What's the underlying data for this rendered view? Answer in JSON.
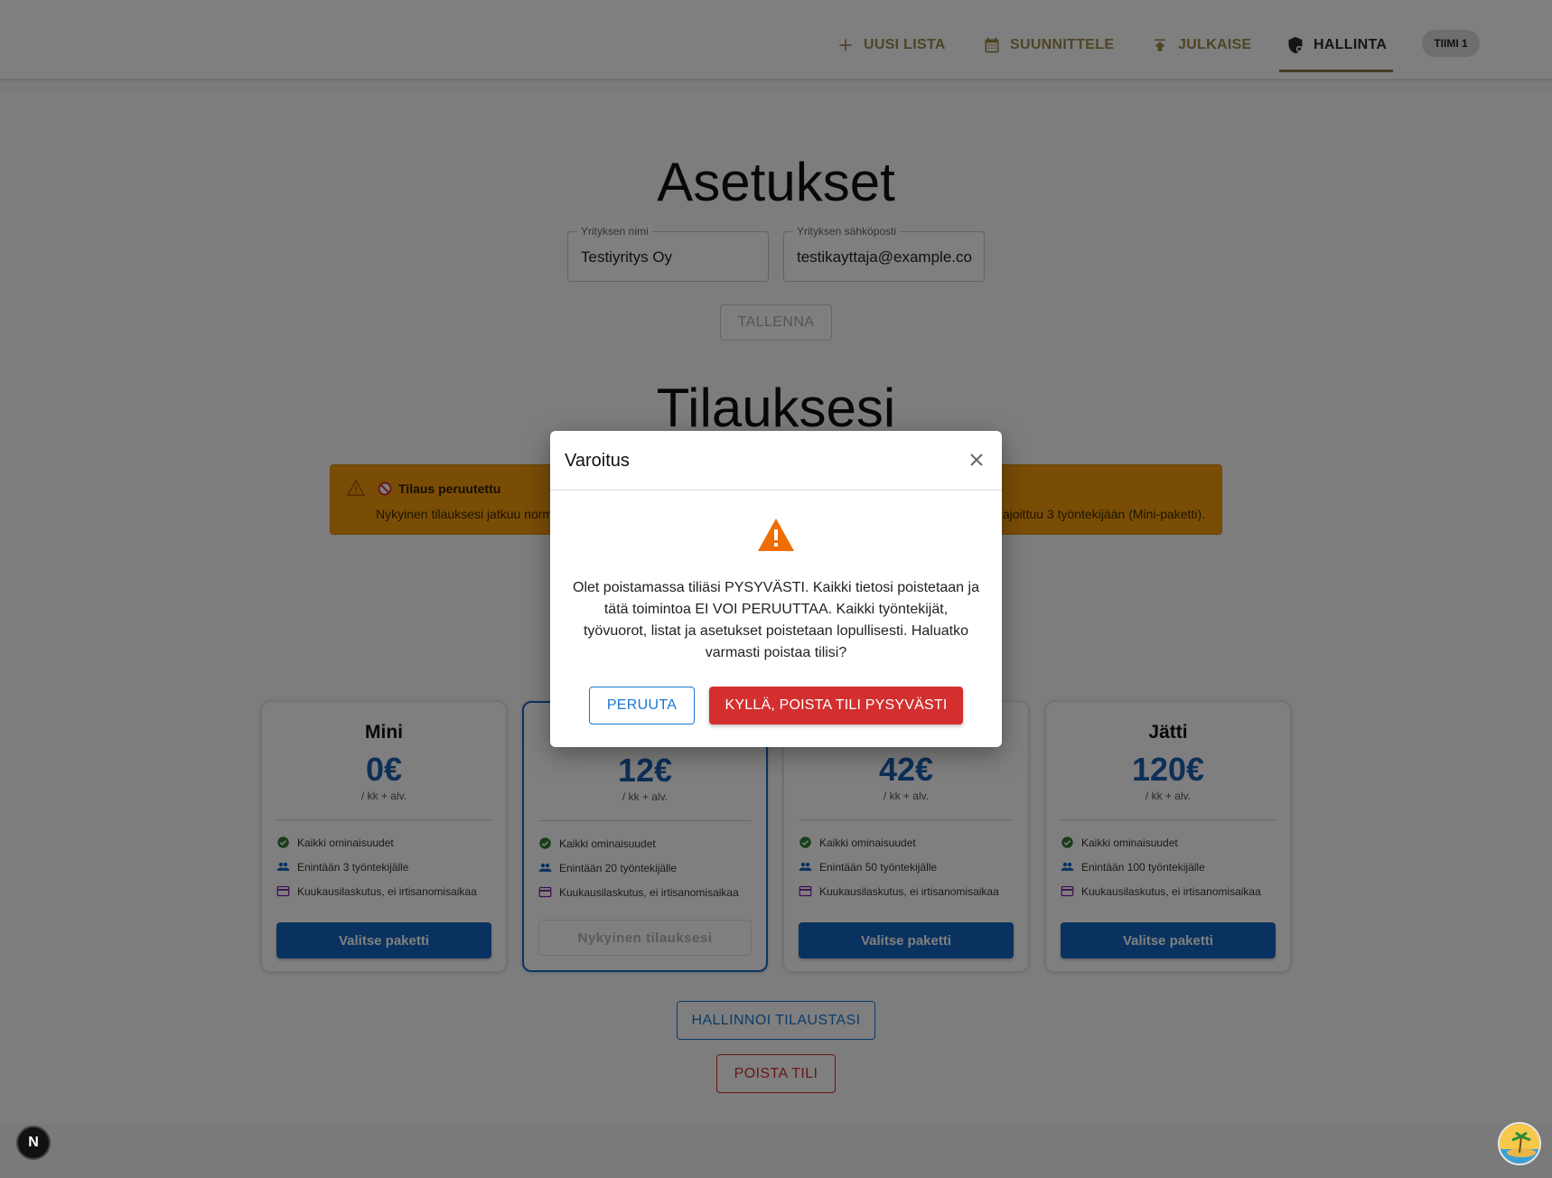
{
  "nav": {
    "items": [
      {
        "label": "UUSI LISTA",
        "icon": "plus-icon"
      },
      {
        "label": "SUUNNITTELE",
        "icon": "calendar-icon"
      },
      {
        "label": "JULKAISE",
        "icon": "publish-icon"
      },
      {
        "label": "HALLINTA",
        "icon": "admin-shield-icon",
        "active": true
      }
    ],
    "team_badge": "TIIMI 1",
    "active_color": "#8a7845"
  },
  "settings": {
    "title": "Asetukset",
    "company_name_label": "Yrityksen nimi",
    "company_name_value": "Testiyritys Oy",
    "company_email_label": "Yrityksen sähköposti",
    "company_email_value": "testikayttaja@example.com",
    "save_label": "TALLENNA"
  },
  "subscription": {
    "title": "Tilauksesi",
    "alert": {
      "title": "Tilaus peruutettu",
      "text_left": "Nykyinen tilauksesi jatkuu norm",
      "text_right": "ajoittuu 3 työntekijään (Mini-paketti).",
      "color": "#f59a0d"
    },
    "plans": [
      {
        "name": "Mini",
        "price": "0€",
        "per": "/ kk + alv.",
        "features": [
          "Kaikki ominaisuudet",
          "Enintään 3 työntekijälle",
          "Kuukausilaskutus, ei irtisanomisaikaa"
        ],
        "cta": "Valitse paketti",
        "current": false
      },
      {
        "name": "",
        "price": "12€",
        "per": "/ kk + alv.",
        "features": [
          "Kaikki ominaisuudet",
          "Enintään 20 työntekijälle",
          "Kuukausilaskutus, ei irtisanomisaikaa"
        ],
        "cta": "Nykyinen tilauksesi",
        "current": true
      },
      {
        "name": "",
        "price": "42€",
        "per": "/ kk + alv.",
        "features": [
          "Kaikki ominaisuudet",
          "Enintään 50 työntekijälle",
          "Kuukausilaskutus, ei irtisanomisaikaa"
        ],
        "cta": "Valitse paketti",
        "current": false
      },
      {
        "name": "Jätti",
        "price": "120€",
        "per": "/ kk + alv.",
        "features": [
          "Kaikki ominaisuudet",
          "Enintään 100 työntekijälle",
          "Kuukausilaskutus, ei irtisanomisaikaa"
        ],
        "cta": "Valitse paketti",
        "current": false
      }
    ],
    "manage_label": "HALLINNOI TILAUSTASI",
    "delete_label": "POISTA TILI",
    "price_color": "#1a5fb0"
  },
  "modal": {
    "title": "Varoitus",
    "message": "Olet poistamassa tiliäsi PYSYVÄSTI. Kaikki tietosi poistetaan ja tätä toimintoa EI VOI PERUUTTAA. Kaikki työntekijät, työvuorot, listat ja asetukset poistetaan lopullisesti. Haluatko varmasti poistaa tilisi?",
    "cancel_label": "PERUUTA",
    "confirm_label": "KYLLÄ, POISTA TILI PYSYVÄSTI",
    "confirm_color": "#d32f2f",
    "warning_color": "#ef6c00"
  },
  "dev_badge": "N"
}
